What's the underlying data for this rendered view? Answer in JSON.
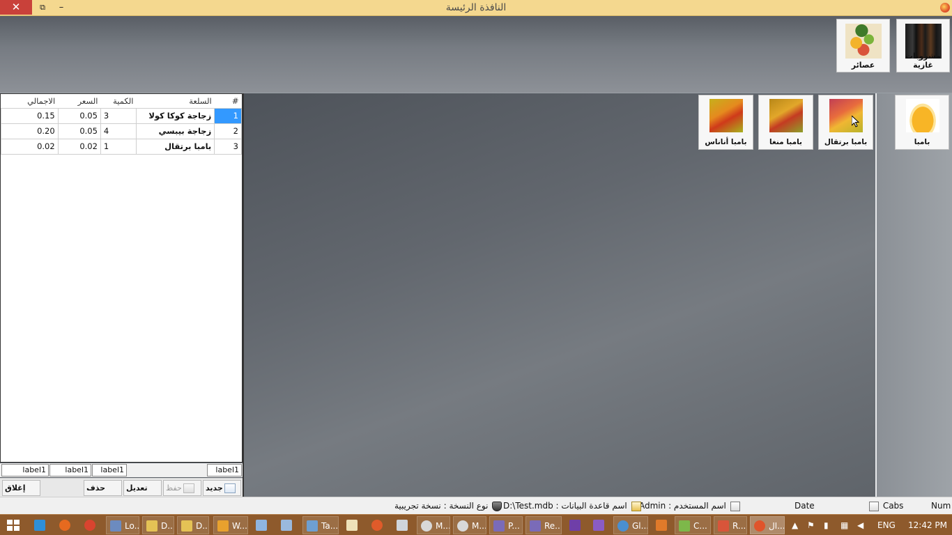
{
  "window": {
    "title": "النافذة الرئيسة",
    "close_glyph": "✕",
    "restore_glyph": "⧉",
    "minimize_glyph": "–"
  },
  "categories": [
    {
      "label": "مشروبات غازية",
      "icon": "soda-bottles-icon"
    },
    {
      "label": "عصائر",
      "icon": "fruit-basket-icon"
    }
  ],
  "grid": {
    "headers": {
      "num": "#",
      "item": "السلعة",
      "qty": "الكمية",
      "price": "السعر",
      "total": "الاجمالي"
    },
    "rows": [
      {
        "num": "1",
        "item": "زجاجة كوكا كولا",
        "qty": "3",
        "price": "0.05",
        "total": "0.15"
      },
      {
        "num": "2",
        "item": "زجاجة بيبسي",
        "qty": "4",
        "price": "0.05",
        "total": "0.20"
      },
      {
        "num": "3",
        "item": "بامبا برتقال",
        "qty": "1",
        "price": "0.02",
        "total": "0.02"
      }
    ]
  },
  "labels": [
    "label1",
    "label1",
    "label1",
    "label1"
  ],
  "toolbar": {
    "new": "جديد",
    "save": "حفظ",
    "edit": "تعديل",
    "delete": "حذف",
    "close": "إغلاق"
  },
  "products": [
    {
      "label": "بامبا",
      "icon": "juice-glass-icon"
    },
    {
      "label": "بامبا برتقال",
      "icon": "orange-juice-pack-icon"
    },
    {
      "label": "بامبا منغا",
      "icon": "mango-juice-pack-icon"
    },
    {
      "label": "بامبا أناناس",
      "icon": "pineapple-juice-pack-icon"
    }
  ],
  "status": {
    "user_label": "اسم المستخدم :",
    "user_value": "Admin",
    "db_label": "اسم قاعدة البيانات :",
    "db_value": "D:\\Test.mdb",
    "version_label": "نوع النسخة :",
    "version_value": "نسخة تجريبية",
    "date": "Date",
    "caps": "Cabs",
    "num": "Num"
  },
  "taskbar": {
    "items": [
      "Lo...",
      "D...",
      "D...",
      "W...",
      "Ta...",
      "M...",
      "M...",
      "P...",
      "Re...",
      "Gl...",
      "C...",
      "R...",
      "ال..."
    ],
    "lang": "ENG",
    "time": "12:42 PM"
  },
  "colors": {
    "title_bar": "#f4d88f",
    "close_button": "#c9413a",
    "selection": "#3399ff",
    "taskbar": "#8e5a2c"
  }
}
